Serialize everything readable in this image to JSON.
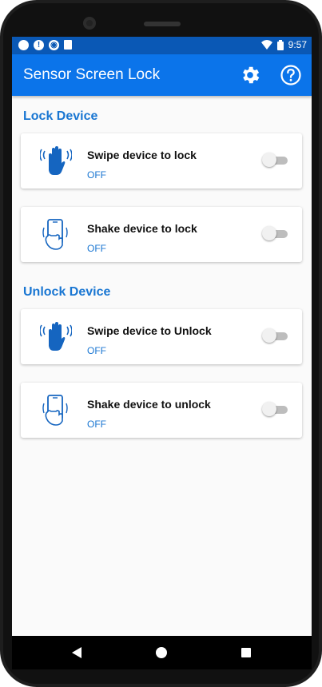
{
  "status_bar": {
    "time": "9:57"
  },
  "app_bar": {
    "title": "Sensor Screen Lock"
  },
  "sections": [
    {
      "title": "Lock Device",
      "items": [
        {
          "label": "Swipe device to lock",
          "state": "OFF",
          "icon": "swipe-hand-icon"
        },
        {
          "label": "Shake device to lock",
          "state": "OFF",
          "icon": "shake-phone-icon"
        }
      ]
    },
    {
      "title": "Unlock Device",
      "items": [
        {
          "label": "Swipe device to Unlock",
          "state": "OFF",
          "icon": "swipe-hand-icon"
        },
        {
          "label": "Shake device to unlock",
          "state": "OFF",
          "icon": "shake-phone-icon"
        }
      ]
    }
  ],
  "colors": {
    "primary": "#0b74ea",
    "status": "#0a58b5",
    "accent": "#1976d2"
  }
}
